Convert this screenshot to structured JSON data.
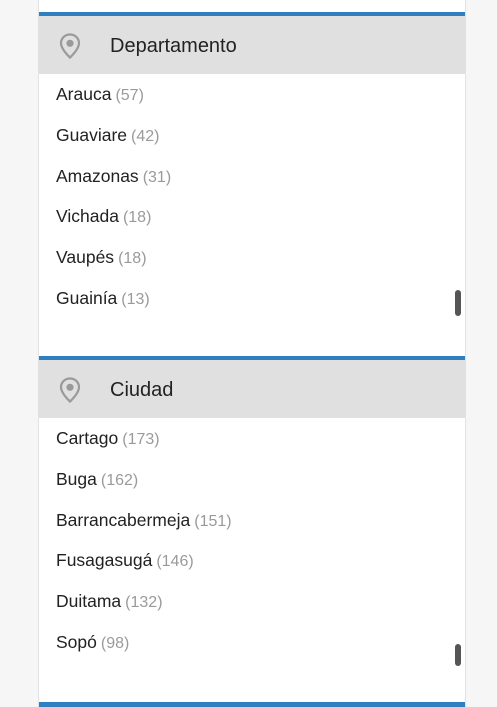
{
  "colors": {
    "accent": "#2f7fc1",
    "header_bg": "#e0e0e0",
    "count_text": "#9a9a9a",
    "icon": "#9a9a9a"
  },
  "departamento": {
    "icon": "map-pin-icon",
    "title": "Departamento",
    "items": [
      {
        "name": "Arauca",
        "count": "(57)"
      },
      {
        "name": "Guaviare",
        "count": "(42)"
      },
      {
        "name": "Amazonas",
        "count": "(31)"
      },
      {
        "name": "Vichada",
        "count": "(18)"
      },
      {
        "name": "Vaupés",
        "count": "(18)"
      },
      {
        "name": "Guainía",
        "count": "(13)"
      }
    ]
  },
  "ciudad": {
    "icon": "map-pin-icon",
    "title": "Ciudad",
    "items": [
      {
        "name": "Cartago",
        "count": "(173)"
      },
      {
        "name": "Buga",
        "count": "(162)"
      },
      {
        "name": "Barrancabermeja",
        "count": "(151)"
      },
      {
        "name": "Fusagasugá",
        "count": "(146)"
      },
      {
        "name": "Duitama",
        "count": "(132)"
      },
      {
        "name": "Sopó",
        "count": "(98)"
      }
    ]
  }
}
